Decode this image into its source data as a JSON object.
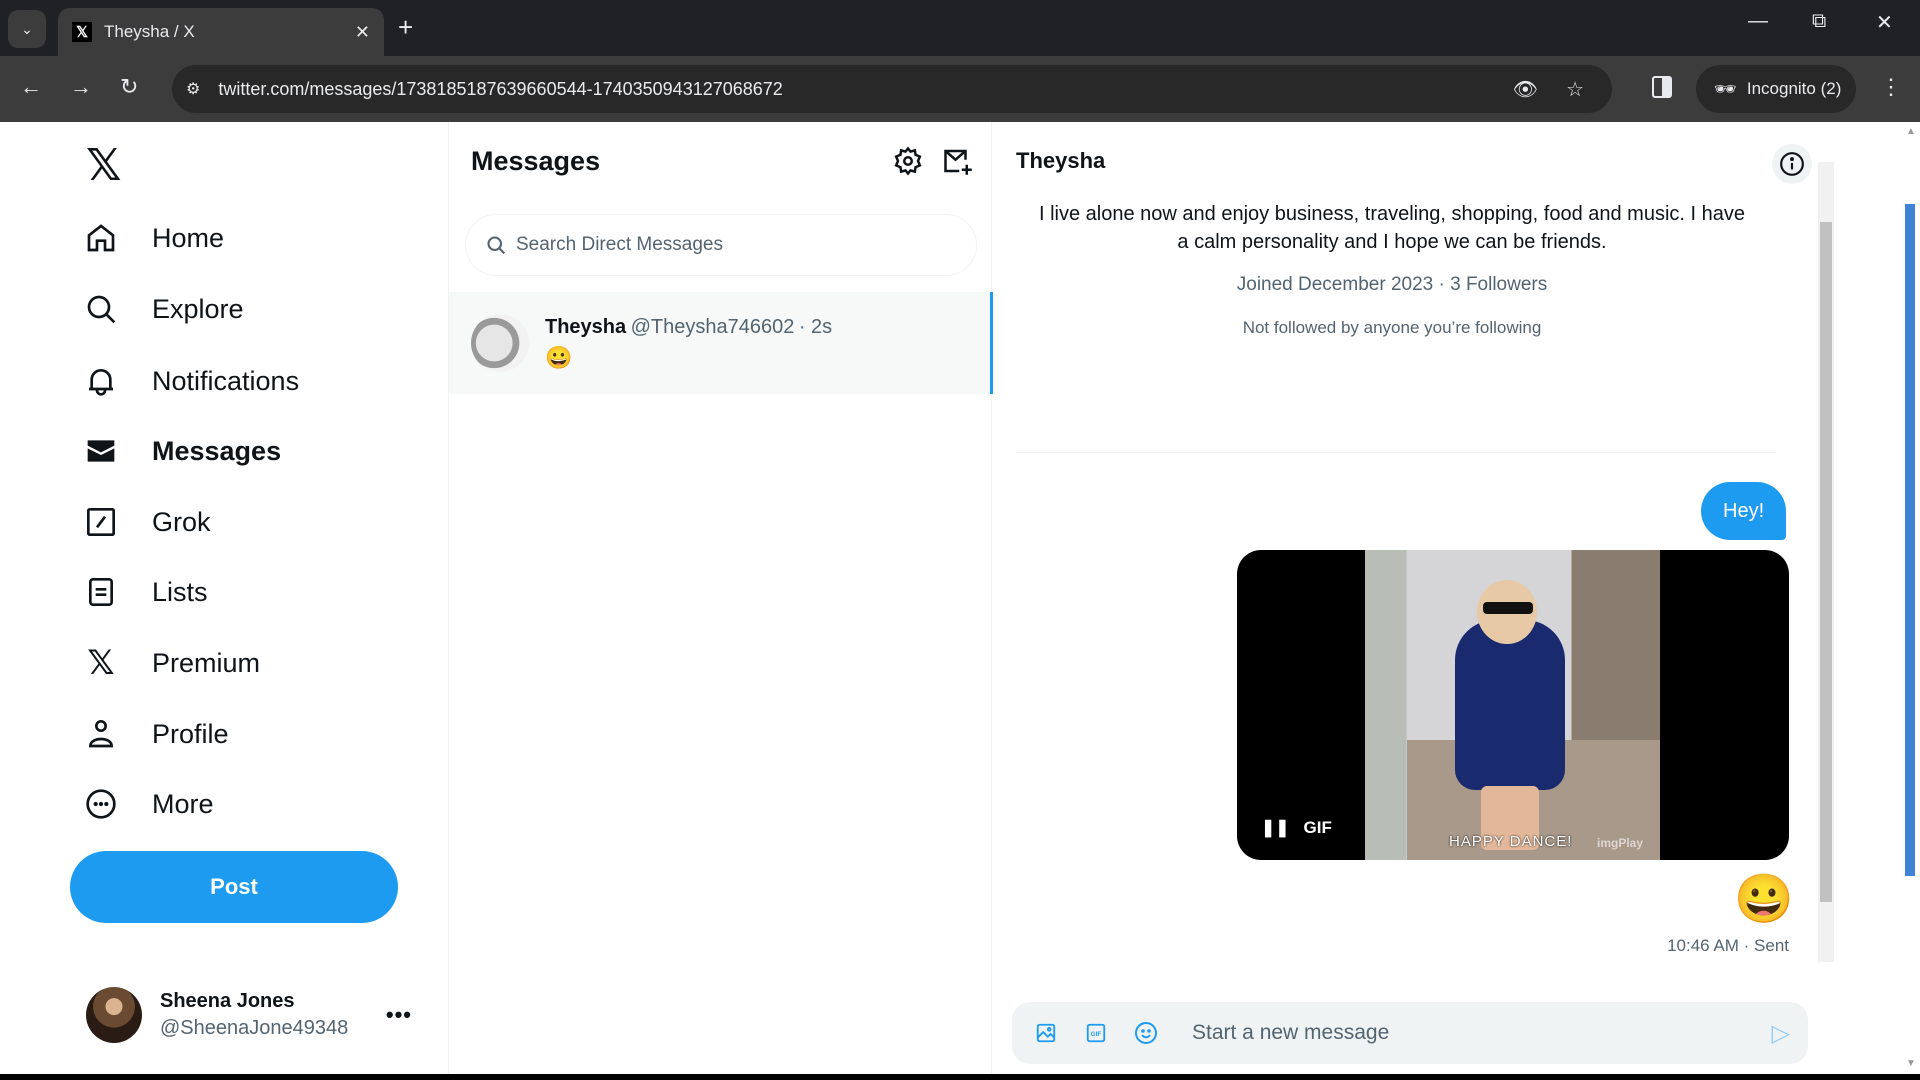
{
  "browser": {
    "tab_title": "Theysha / X",
    "url": "twitter.com/messages/1738185187639660544-1740350943127068672",
    "incognito_label": "Incognito (2)",
    "new_tab_icon": "plus-icon",
    "window_controls": [
      "minimize",
      "restore",
      "close"
    ]
  },
  "nav": {
    "logo": "X",
    "items": [
      {
        "label": "Home",
        "icon": "home-icon"
      },
      {
        "label": "Explore",
        "icon": "search-icon"
      },
      {
        "label": "Notifications",
        "icon": "bell-icon"
      },
      {
        "label": "Messages",
        "icon": "envelope-icon",
        "active": true
      },
      {
        "label": "Grok",
        "icon": "grok-icon"
      },
      {
        "label": "Lists",
        "icon": "list-icon"
      },
      {
        "label": "Premium",
        "icon": "x-icon"
      },
      {
        "label": "Profile",
        "icon": "person-icon"
      },
      {
        "label": "More",
        "icon": "more-circle-icon"
      }
    ],
    "post_label": "Post",
    "account": {
      "name": "Sheena Jones",
      "handle": "@SheenaJone49348",
      "more": "•••"
    }
  },
  "messages": {
    "title": "Messages",
    "search_placeholder": "Search Direct Messages",
    "conversations": [
      {
        "name": "Theysha",
        "handle": "@Theysha746602",
        "time": "· 2s",
        "preview": "😀",
        "selected": true
      }
    ]
  },
  "conversation": {
    "title": "Theysha",
    "bio": "I live alone now and enjoy business, traveling, shopping, food and music. I have a calm personality and I hope we can be friends.",
    "joined": "Joined December 2023 · 3 Followers",
    "not_followed": "Not followed by anyone you’re following",
    "messages": [
      {
        "type": "text",
        "text": "Hey!"
      },
      {
        "type": "gif",
        "caption": "HAPPY DANCE!",
        "watermark": "imgPlay",
        "badge": "GIF"
      },
      {
        "type": "emoji",
        "text": "😀"
      }
    ],
    "status": "10:46 AM · Sent",
    "composer_placeholder": "Start a new message"
  },
  "colors": {
    "accent": "#1d9bf0",
    "text": "#0f1419",
    "muted": "#536471"
  }
}
